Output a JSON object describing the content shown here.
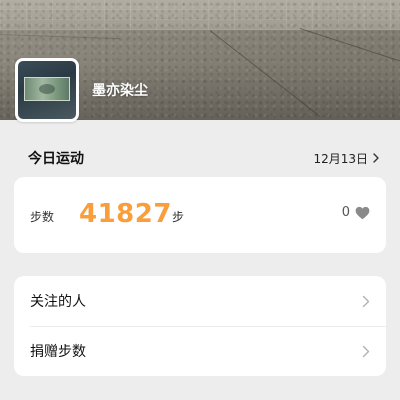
{
  "profile": {
    "username": "墨亦染尘",
    "avatar_icon": "banknote-avatar"
  },
  "today": {
    "title": "今日运动",
    "date": "12月13日"
  },
  "steps": {
    "label": "步数",
    "count": "41827",
    "unit": "步",
    "likes": "0",
    "accent_color": "#fa9d3b"
  },
  "menu": {
    "items": [
      {
        "label": "关注的人"
      },
      {
        "label": "捐赠步数"
      }
    ]
  }
}
